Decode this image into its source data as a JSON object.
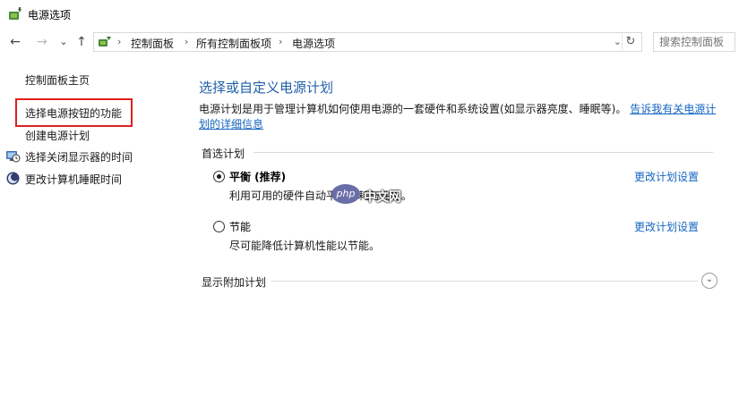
{
  "window": {
    "title": "电源选项"
  },
  "nav": {
    "back_glyph": "←",
    "forward_glyph": "→",
    "recent_glyph": "⌄",
    "up_glyph": "↑",
    "breadcrumbs": [
      "控制面板",
      "所有控制面板项",
      "电源选项"
    ],
    "separator": "›",
    "dropdown_glyph": "⌄",
    "refresh_glyph": "↻",
    "search_placeholder": "搜索控制面板"
  },
  "sidebar": {
    "home_link": "控制面板主页",
    "links": [
      {
        "label": "选择电源按钮的功能",
        "icon": "none",
        "highlighted": true
      },
      {
        "label": "创建电源计划",
        "icon": "none"
      },
      {
        "label": "选择关闭显示器的时间",
        "icon": "monitor-clock-icon"
      },
      {
        "label": "更改计算机睡眠时间",
        "icon": "moon-sleep-icon"
      }
    ]
  },
  "main": {
    "title": "选择或自定义电源计划",
    "description": "电源计划是用于管理计算机如何使用电源的一套硬件和系统设置(如显示器亮度、睡眠等)。",
    "description_link": "告诉我有关电源计划的详细信息",
    "preferred_label": "首选计划",
    "plans": [
      {
        "name": "平衡 (推荐)",
        "desc": "利用可用的硬件自动平衡功耗与性能。",
        "selected": true,
        "change_link": "更改计划设置"
      },
      {
        "name": "节能",
        "desc": "尽可能降低计算机性能以节能。",
        "selected": false,
        "change_link": "更改计划设置"
      }
    ],
    "additional_label": "显示附加计划",
    "expand_glyph": "⌄"
  },
  "watermark": {
    "logo": "php",
    "text": "中文网"
  },
  "colors": {
    "link": "#1565c0",
    "title": "#1f5fa8",
    "highlight_border": "#e02020"
  }
}
